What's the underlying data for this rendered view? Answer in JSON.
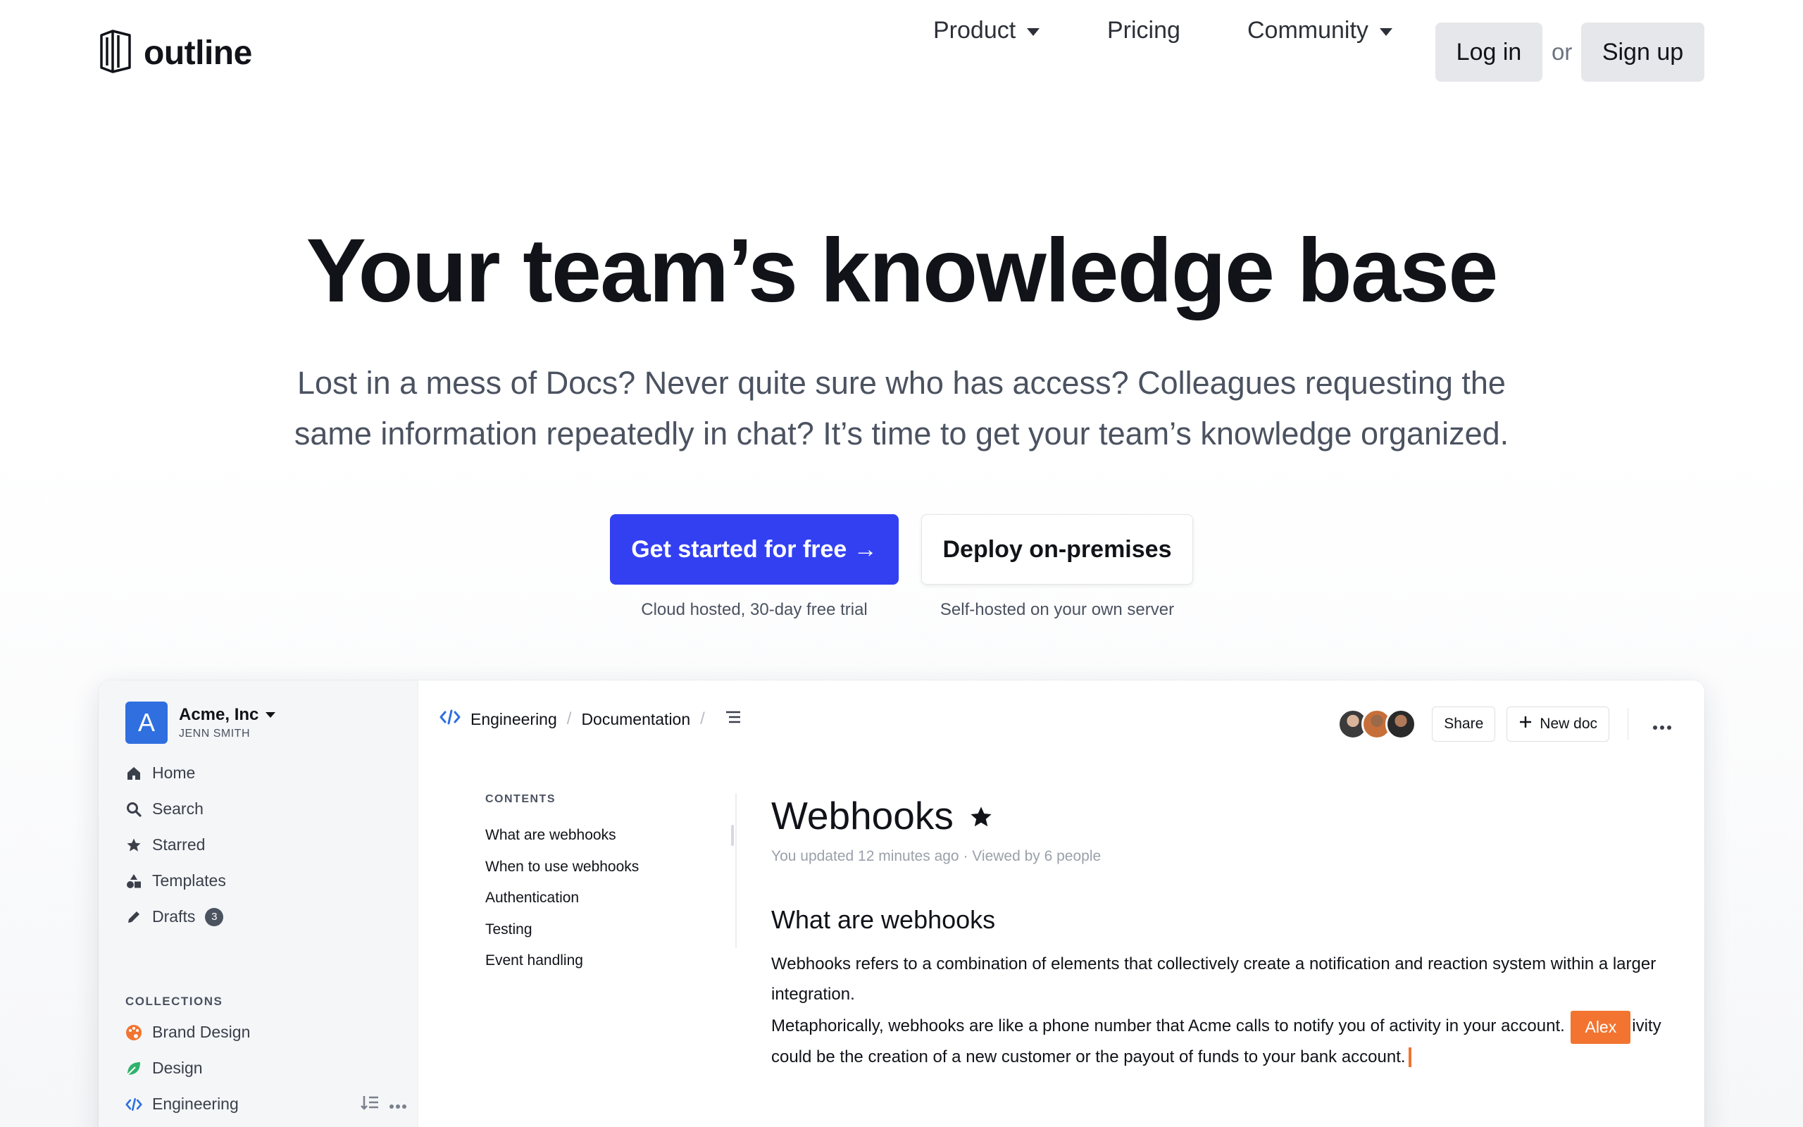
{
  "brand": {
    "name": "outline"
  },
  "nav": {
    "product": "Product",
    "pricing": "Pricing",
    "community": "Community",
    "login": "Log in",
    "or": "or",
    "signup": "Sign up"
  },
  "hero": {
    "title": "Your team’s knowledge base",
    "subtitle": "Lost in a mess of Docs? Never quite sure who has access? Colleagues requesting the same information repeatedly in chat? It’s time to get your team’s knowledge organized.",
    "primary_cta": "Get started for free →",
    "primary_caption": "Cloud hosted, 30-day free trial",
    "secondary_cta": "Deploy on-premises",
    "secondary_caption": "Self-hosted on your own server"
  },
  "app": {
    "team": {
      "initial": "A",
      "name": "Acme, Inc",
      "user": "JENN SMITH"
    },
    "sidebar": [
      {
        "label": "Home",
        "icon": "home-icon"
      },
      {
        "label": "Search",
        "icon": "search-icon"
      },
      {
        "label": "Starred",
        "icon": "star-icon"
      },
      {
        "label": "Templates",
        "icon": "shapes-icon"
      },
      {
        "label": "Drafts",
        "icon": "pencil-icon",
        "badge": "3"
      }
    ],
    "collections_heading": "COLLECTIONS",
    "collections": [
      {
        "label": "Brand Design",
        "icon": "palette-icon",
        "color": "#f27430"
      },
      {
        "label": "Design",
        "icon": "leaf-icon",
        "color": "#2fb36b"
      },
      {
        "label": "Engineering",
        "icon": "code-icon",
        "color": "#2f6fe0"
      }
    ],
    "breadcrumbs": {
      "collection": "Engineering",
      "doc": "Documentation"
    },
    "header_buttons": {
      "share": "Share",
      "new_doc": "New doc"
    },
    "contents": {
      "title": "CONTENTS",
      "items": [
        "What are webhooks",
        "When to use webhooks",
        "Authentication",
        "Testing",
        "Event handling"
      ]
    },
    "doc": {
      "title": "Webhooks",
      "meta": "You updated 12 minutes ago · Viewed by 6 people",
      "heading": "What are webhooks",
      "p1": "Webhooks refers to a combination of elements that collectively create a notification and reaction system within a larger integration.",
      "p2_start": "Metaphorically, webhooks are like a phone number that Acme calls to notify you of activity in your account.",
      "cursor_label": "Alex",
      "p2_end": "ivity could be the creation of a new customer or the payout of funds to your bank account."
    },
    "colors": {
      "accent": "#3340f2",
      "cursor": "#f27430",
      "team": "#2f6fe0"
    }
  }
}
